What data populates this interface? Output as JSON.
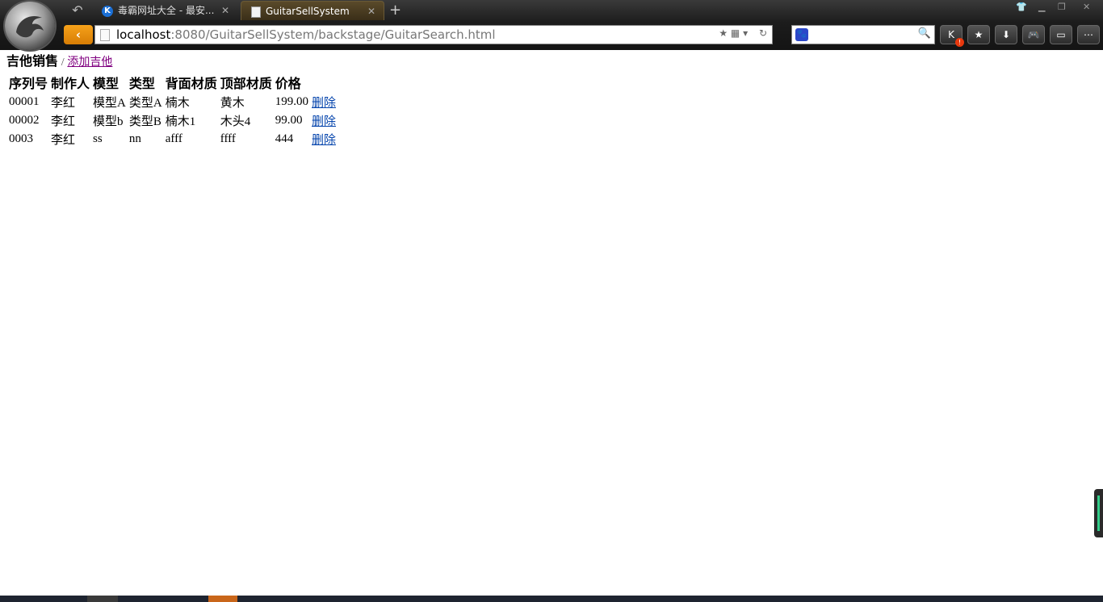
{
  "browser": {
    "tabs": [
      {
        "title": "毒霸网址大全 - 最安...",
        "icon": "k-logo-icon",
        "active": false
      },
      {
        "title": "GuitarSellSystem",
        "icon": "page-icon",
        "active": true
      }
    ],
    "url_host": "localhost",
    "url_rest": ":8080/GuitarSellSystem/backstage/GuitarSearch.html",
    "toolbar_icons": [
      "k-plugin-icon",
      "star-icon",
      "download-icon",
      "gamepad-icon",
      "tv-icon",
      "menu-icon"
    ]
  },
  "page": {
    "heading": "吉他销售",
    "separator": "/",
    "add_link": "添加吉他",
    "columns": [
      "序列号",
      "制作人",
      "模型",
      "类型",
      "背面材质",
      "顶部材质",
      "价格"
    ],
    "rows": [
      {
        "serial": "00001",
        "builder": "李红",
        "model": "模型A",
        "type": "类型A",
        "back": "楠木",
        "top": "黄木",
        "price": "199.00",
        "action": "删除"
      },
      {
        "serial": "00002",
        "builder": "李红",
        "model": "模型b",
        "type": "类型B",
        "back": "楠木1",
        "top": "木头4",
        "price": "99.00",
        "action": "删除"
      },
      {
        "serial": "0003",
        "builder": "李红",
        "model": "ss",
        "type": "nn",
        "back": "afff",
        "top": "ffff",
        "price": "444",
        "action": "删除"
      }
    ]
  },
  "colors": {
    "link": "#0645ad",
    "visited_link": "#800080",
    "accent_orange": "#f6a21a"
  }
}
